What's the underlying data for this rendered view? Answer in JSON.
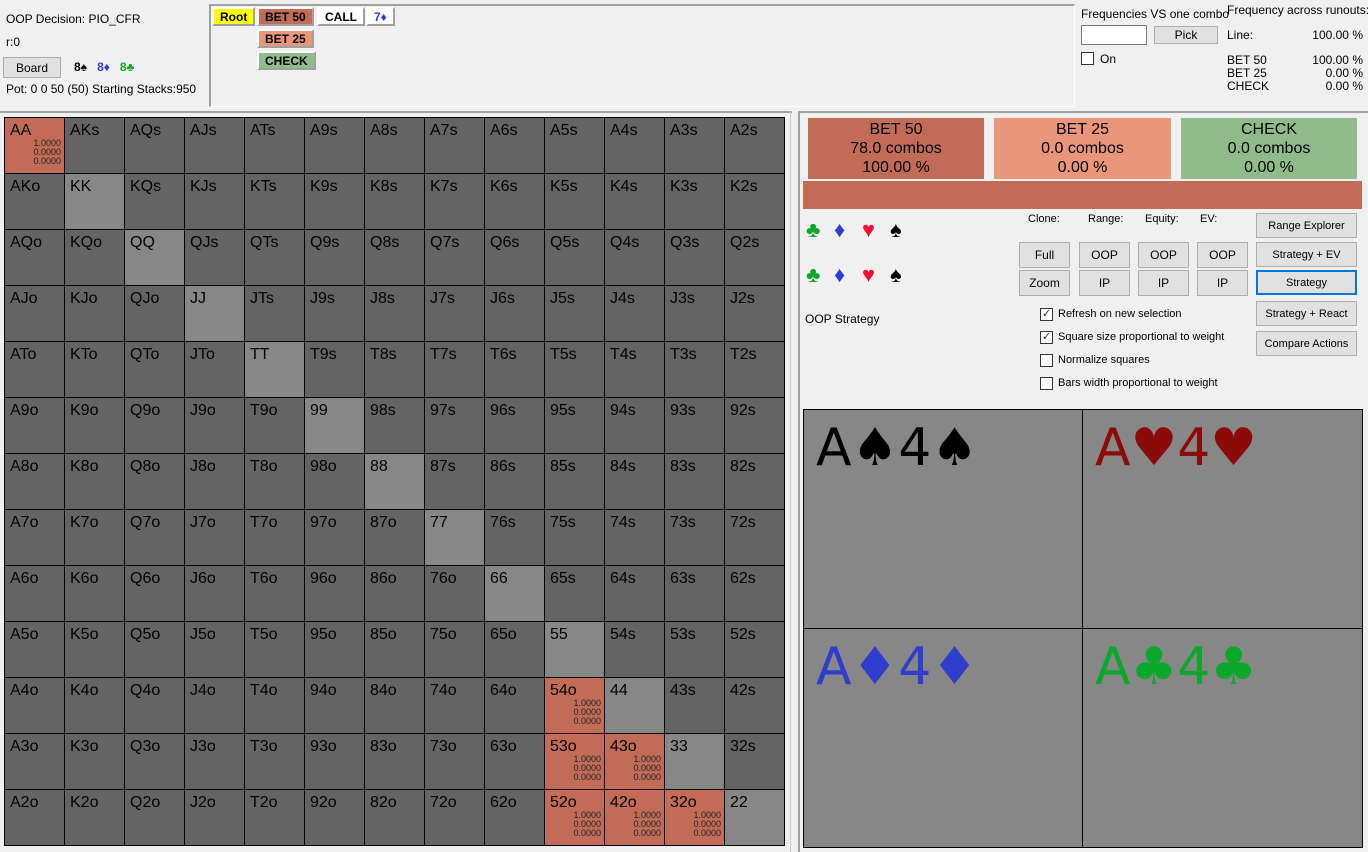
{
  "header": {
    "decision": "OOP Decision:  PIO_CFR",
    "r": "r:0",
    "board_button": "Board",
    "board_cards": [
      {
        "text": "8♠",
        "color": "#000000"
      },
      {
        "text": "8♦",
        "color": "#2f3ccc"
      },
      {
        "text": "8♣",
        "color": "#0ea62a"
      }
    ],
    "pot": "Pot: 0 0 50 (50) Starting Stacks:950"
  },
  "tree": {
    "root": "Root",
    "bet50": "BET 50",
    "bet25": "BET 25",
    "check": "CHECK",
    "call": "CALL",
    "turn_card": "7♦"
  },
  "freq_vs_combo": {
    "title": "Frequencies VS one combo",
    "input_value": "",
    "pick_label": "Pick",
    "on_label": "On",
    "on_checked": false
  },
  "freq_runouts": {
    "title": "Frequency across runouts:",
    "line_label": "Line:",
    "line_value": "100.00 %",
    "rows": [
      {
        "label": "BET 50",
        "value": "100.00 %"
      },
      {
        "label": "BET 25",
        "value": "0.00 %"
      },
      {
        "label": "CHECK",
        "value": "0.00 %"
      }
    ]
  },
  "colors": {
    "bet50": "#c26c58",
    "bet25": "#ea967b",
    "check": "#8fbc8a",
    "pair_cell": "#878787",
    "empty_cell": "#646464",
    "root": "#ffff00"
  },
  "matrix": {
    "ranks": [
      "A",
      "K",
      "Q",
      "J",
      "T",
      "9",
      "8",
      "7",
      "6",
      "5",
      "4",
      "3",
      "2"
    ],
    "active": {
      "AA": [
        "1.0000",
        "0.0000",
        "0.0000"
      ],
      "54o": [
        "1.0000",
        "0.0000",
        "0.0000"
      ],
      "53o": [
        "1.0000",
        "0.0000",
        "0.0000"
      ],
      "43o": [
        "1.0000",
        "0.0000",
        "0.0000"
      ],
      "52o": [
        "1.0000",
        "0.0000",
        "0.0000"
      ],
      "42o": [
        "1.0000",
        "0.0000",
        "0.0000"
      ],
      "32o": [
        "1.0000",
        "0.0000",
        "0.0000"
      ]
    }
  },
  "actions": [
    {
      "name": "BET 50",
      "combos": "78.0 combos",
      "pct": "100.00 %"
    },
    {
      "name": "BET 25",
      "combos": "0.0 combos",
      "pct": "0.00 %"
    },
    {
      "name": "CHECK",
      "combos": "0.0 combos",
      "pct": "0.00 %"
    }
  ],
  "strategy_bar": {
    "bet50": 1.0,
    "bet25": 0.0,
    "check": 0.0
  },
  "suit_filters": {
    "row1": [
      {
        "s": "♣",
        "c": "#0ea62a"
      },
      {
        "s": "♦",
        "c": "#2f3ccc"
      },
      {
        "s": "♥",
        "c": "#ee1133"
      },
      {
        "s": "♠",
        "c": "#000000"
      }
    ],
    "row2": [
      {
        "s": "♣",
        "c": "#0ea62a"
      },
      {
        "s": "♦",
        "c": "#2f3ccc"
      },
      {
        "s": "♥",
        "c": "#ee1133"
      },
      {
        "s": "♠",
        "c": "#000000"
      }
    ]
  },
  "controls": {
    "clone_label": "Clone:",
    "range_label": "Range:",
    "equity_label": "Equity:",
    "ev_label": "EV:",
    "full": "Full",
    "zoom": "Zoom",
    "oop": "OOP",
    "ip": "IP",
    "strategy_label": "OOP Strategy",
    "checkboxes": [
      {
        "label": "Refresh on new selection",
        "checked": true
      },
      {
        "label": "Square size proportional to weight",
        "checked": true
      },
      {
        "label": "Normalize squares",
        "checked": false
      },
      {
        "label": "Bars width proportional to weight",
        "checked": false
      }
    ],
    "view_buttons": [
      "Range Explorer",
      "Strategy + EV",
      "Strategy",
      "Strategy + React",
      "Compare Actions"
    ],
    "selected_view": "Strategy"
  },
  "combos": [
    {
      "text": "A♠4♠",
      "color": "#000000"
    },
    {
      "text": "A♥4♥",
      "color": "#8b0a0a"
    },
    {
      "text": "A♦4♦",
      "color": "#2f3ccc"
    },
    {
      "text": "A♣4♣",
      "color": "#0aa82a"
    }
  ]
}
